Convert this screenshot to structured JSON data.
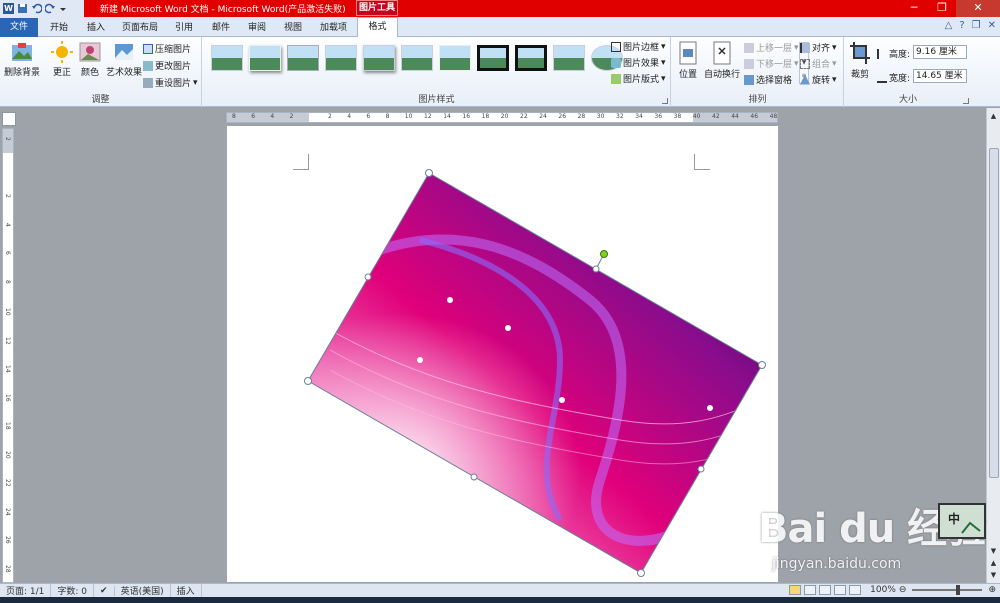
{
  "title_bar": {
    "document_title": "新建 Microsoft Word 文档 - Microsoft Word(产品激活失败)",
    "contextual_tab": "图片工具",
    "window_buttons": [
      "─",
      "❐",
      "✕"
    ]
  },
  "tabs": {
    "file": "文件",
    "items": [
      "开始",
      "插入",
      "页面布局",
      "引用",
      "邮件",
      "审阅",
      "视图",
      "加载项"
    ],
    "active": "格式"
  },
  "ribbon": {
    "adjust": {
      "label": "调整",
      "remove_bg": "删除背景",
      "corrections": "更正",
      "color": "颜色",
      "artistic": "艺术效果",
      "compress": "压缩图片",
      "change": "更改图片",
      "reset": "重设图片"
    },
    "styles": {
      "label": "图片样式",
      "border": "图片边框",
      "effects": "图片效果",
      "layout": "图片版式"
    },
    "arrange": {
      "label": "排列",
      "position": "位置",
      "wrap": "自动换行",
      "forward": "上移一层",
      "backward": "下移一层",
      "pane": "选择窗格",
      "align": "对齐",
      "group": "组合",
      "rotate": "旋转"
    },
    "size": {
      "label": "大小",
      "crop": "裁剪",
      "height_label": "高度:",
      "height_value": "9.16 厘米",
      "width_label": "宽度:",
      "width_value": "14.65 厘米"
    }
  },
  "ruler": {
    "h_ticks": [
      "8",
      "6",
      "4",
      "2",
      "",
      "2",
      "4",
      "6",
      "8",
      "10",
      "12",
      "14",
      "16",
      "18",
      "20",
      "22",
      "24",
      "26",
      "28",
      "30",
      "32",
      "34",
      "36",
      "38",
      "40",
      "42",
      "44",
      "46",
      "48"
    ],
    "v_ticks": [
      "2",
      "",
      "2",
      "4",
      "6",
      "8",
      "10",
      "12",
      "14",
      "16",
      "18",
      "20",
      "22",
      "24",
      "26",
      "28"
    ]
  },
  "status_bar": {
    "page": "页面: 1/1",
    "words": "字数: 0",
    "language": "英语(美国)",
    "mode": "插入",
    "zoom": "100%"
  },
  "ime": {
    "label": "中"
  },
  "watermark": {
    "logo": "Bai du 经验",
    "url": "jingyan.baidu.com"
  },
  "colors": {
    "title_bar": "#e00000",
    "file_tab": "#2a66b4",
    "picture_gradient": [
      "#ffffff",
      "#e0007a",
      "#8a0c8c",
      "#1b0d4e"
    ]
  },
  "icons": [
    "word-icon",
    "save-icon",
    "undo-icon",
    "redo-icon",
    "help-icon",
    "minimize-ribbon-icon"
  ]
}
